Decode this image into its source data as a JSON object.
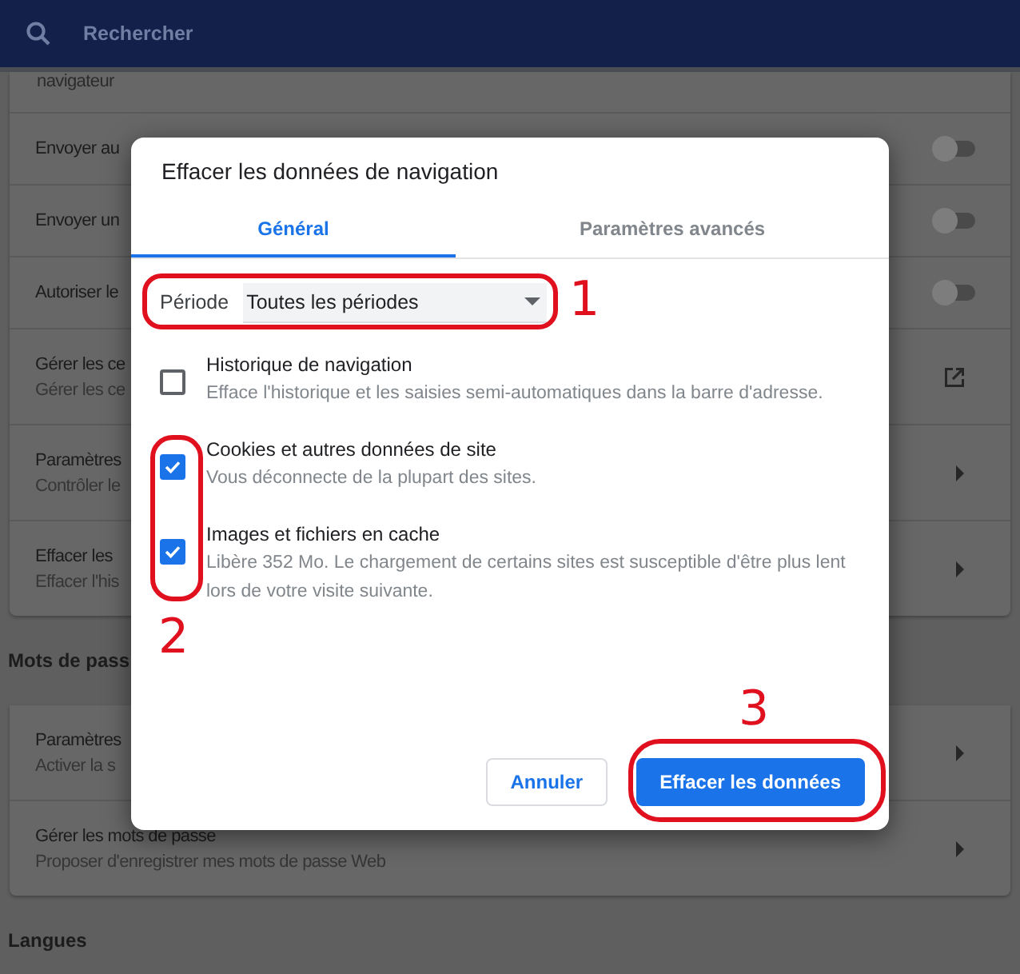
{
  "search": {
    "placeholder": "Rechercher"
  },
  "settings": {
    "top_fragment": "navigateur",
    "rows": [
      {
        "kind": "toggle",
        "title": "Envoyer au",
        "on": false
      },
      {
        "kind": "toggle",
        "title": "Envoyer un",
        "on": false
      },
      {
        "kind": "toggle",
        "title": "Autoriser le",
        "on": false
      },
      {
        "kind": "external",
        "title": "Gérer les ce",
        "subtitle": "Gérer les ce"
      },
      {
        "kind": "arrow",
        "title": "Paramètres",
        "subtitle": "Contrôler le"
      },
      {
        "kind": "arrow",
        "title": "Effacer les",
        "subtitle": "Effacer l'his"
      }
    ],
    "sections": [
      {
        "heading": "Mots de pass",
        "rows": [
          {
            "kind": "arrow",
            "title": "Paramètres",
            "subtitle": "Activer la s"
          },
          {
            "kind": "arrow",
            "title": "Gérer les mots de passe",
            "subtitle": "Proposer d'enregistrer mes mots de passe Web"
          }
        ]
      },
      {
        "heading": "Langues"
      }
    ]
  },
  "dialog": {
    "title": "Effacer les données de navigation",
    "tabs": [
      {
        "label": "Général",
        "selected": true
      },
      {
        "label": "Paramètres avancés",
        "selected": false
      }
    ],
    "period": {
      "label": "Période",
      "value": "Toutes les périodes"
    },
    "options": [
      {
        "title": "Historique de navigation",
        "description": "Efface l'historique et les saisies semi-automatiques dans la barre d'adresse.",
        "checked": false
      },
      {
        "title": "Cookies et autres données de site",
        "description": "Vous déconnecte de la plupart des sites.",
        "checked": true
      },
      {
        "title": "Images et fichiers en cache",
        "description": "Libère 352 Mo. Le chargement de certains sites est susceptible d'être plus lent lors de votre visite suivante.",
        "checked": true
      }
    ],
    "buttons": [
      {
        "label": "Annuler",
        "kind": "secondary"
      },
      {
        "label": "Effacer les données",
        "kind": "primary"
      }
    ]
  },
  "annotations": [
    {
      "label": "1"
    },
    {
      "label": "2"
    },
    {
      "label": "3"
    }
  ]
}
